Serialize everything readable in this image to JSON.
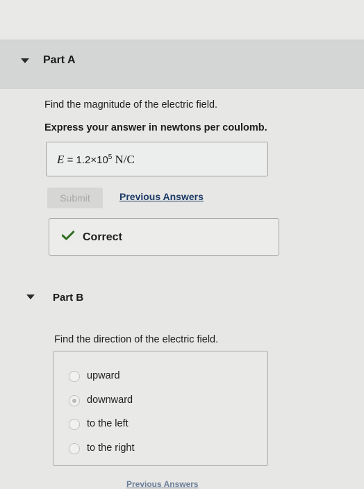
{
  "partA": {
    "title": "Part A",
    "question": "Find the magnitude of the electric field.",
    "instruction": "Express your answer in newtons per coulomb.",
    "answer": {
      "variable": "E",
      "equals": "=",
      "mantissa": "1.2×10",
      "exponent": "5",
      "unit": "N/C"
    },
    "submit_label": "Submit",
    "previous_answers_label": "Previous Answers",
    "feedback": "Correct"
  },
  "partB": {
    "title": "Part B",
    "question": "Find the direction of the electric field.",
    "options": [
      {
        "label": "upward",
        "selected": false
      },
      {
        "label": "downward",
        "selected": true
      },
      {
        "label": "to the left",
        "selected": false
      },
      {
        "label": "to the right",
        "selected": false
      }
    ],
    "previous_answers_label": "Previous Answers"
  },
  "colors": {
    "header_bg": "#d4d6d6",
    "link": "#1c3a66",
    "check": "#2f6e1f"
  },
  "icons": {
    "collapse": "caret-down-icon",
    "correct": "checkmark-icon"
  }
}
